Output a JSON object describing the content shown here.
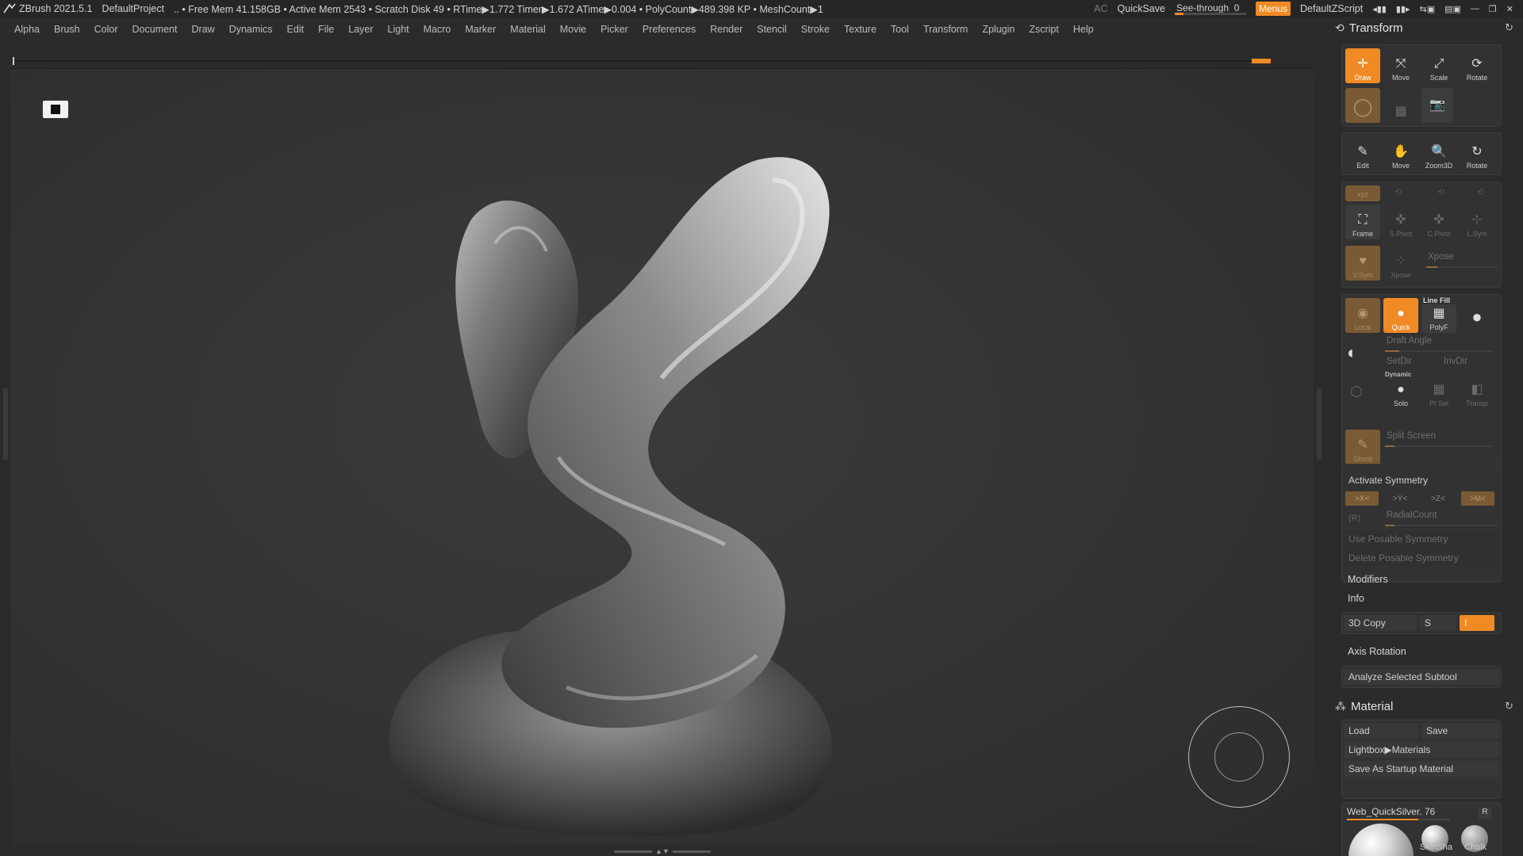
{
  "titlebar": {
    "app": "ZBrush 2021.5.1",
    "project": "DefaultProject",
    "stats": ".. • Free Mem 41.158GB • Active Mem 2543 • Scratch Disk 49 •  RTime▶1.772 Timer▶1.672 ATime▶0.004 • PolyCount▶489.398 KP  • MeshCount▶1",
    "ac": "AC",
    "quicksave": "QuickSave",
    "seethrough_label": "See-through",
    "seethrough_value": "0",
    "seethrough_fraction": 0.12,
    "menus": "Menus",
    "script": "DefaultZScript"
  },
  "menubar": [
    "Alpha",
    "Brush",
    "Color",
    "Document",
    "Draw",
    "Dynamics",
    "Edit",
    "File",
    "Layer",
    "Light",
    "Macro",
    "Marker",
    "Material",
    "Movie",
    "Picker",
    "Preferences",
    "Render",
    "Stencil",
    "Stroke",
    "Texture",
    "Tool",
    "Transform",
    "Zplugin",
    "Zscript",
    "Help"
  ],
  "transform": {
    "title": "Transform",
    "row1": [
      {
        "label": "Draw",
        "icon": "draw-icon",
        "state": "orange"
      },
      {
        "label": "Move",
        "icon": "move-icon",
        "state": "dark"
      },
      {
        "label": "Scale",
        "icon": "scale-icon",
        "state": "dark"
      },
      {
        "label": "Rotate",
        "icon": "rotate-icon",
        "state": "dark"
      }
    ],
    "nav": [
      "Edit",
      "Move",
      "Zoom3D",
      "Rotate"
    ],
    "frame_row": [
      "Frame",
      "S.Pivot",
      "C.Pivot",
      "L.Sym"
    ],
    "xyz_label": "xyz",
    "vsym_label": "V.Sym",
    "xpose_label": "Xpose",
    "xpose_btn": "Xpose",
    "local_label": "Local",
    "quick_label": "Quick",
    "linefill_label": "Line Fill",
    "polyf_label": "PolyF",
    "draft_angle": "Draft Angle",
    "setdir": "SetDir",
    "invdir": "InvDir",
    "dynamic_label": "Dynamic",
    "solo_label": "Solo",
    "ptsel_label": "Pt Sel",
    "transp_label": "Transp",
    "ghost_label": "Ghost",
    "split_screen": "Split Screen",
    "activate_symmetry": "Activate Symmetry",
    "sym_x": ">X<",
    "sym_y": ">Y<",
    "sym_z": ">Z<",
    "sym_m": ">M<",
    "sym_r": "(R)",
    "radial_count": "RadialCount",
    "use_posable": "Use Posable Symmetry",
    "delete_posable": "Delete Posable Symmetry",
    "modifiers": "Modifiers",
    "info": "Info",
    "copy3d": "3D Copy",
    "copy_s": "S",
    "copy_i": "I",
    "axis_rotation": "Axis Rotation",
    "analyze": "Analyze Selected Subtool"
  },
  "material": {
    "title": "Material",
    "load": "Load",
    "save": "Save",
    "lightbox": "Lightbox▶Materials",
    "save_startup": "Save As Startup Material",
    "current": "Web_QuickSilver. 76",
    "r_label": "R",
    "swatches": [
      "SkinSha",
      "Chalk"
    ]
  },
  "colors": {
    "accent": "#f08a24",
    "panel": "#323232",
    "background": "#2b2b2b"
  }
}
